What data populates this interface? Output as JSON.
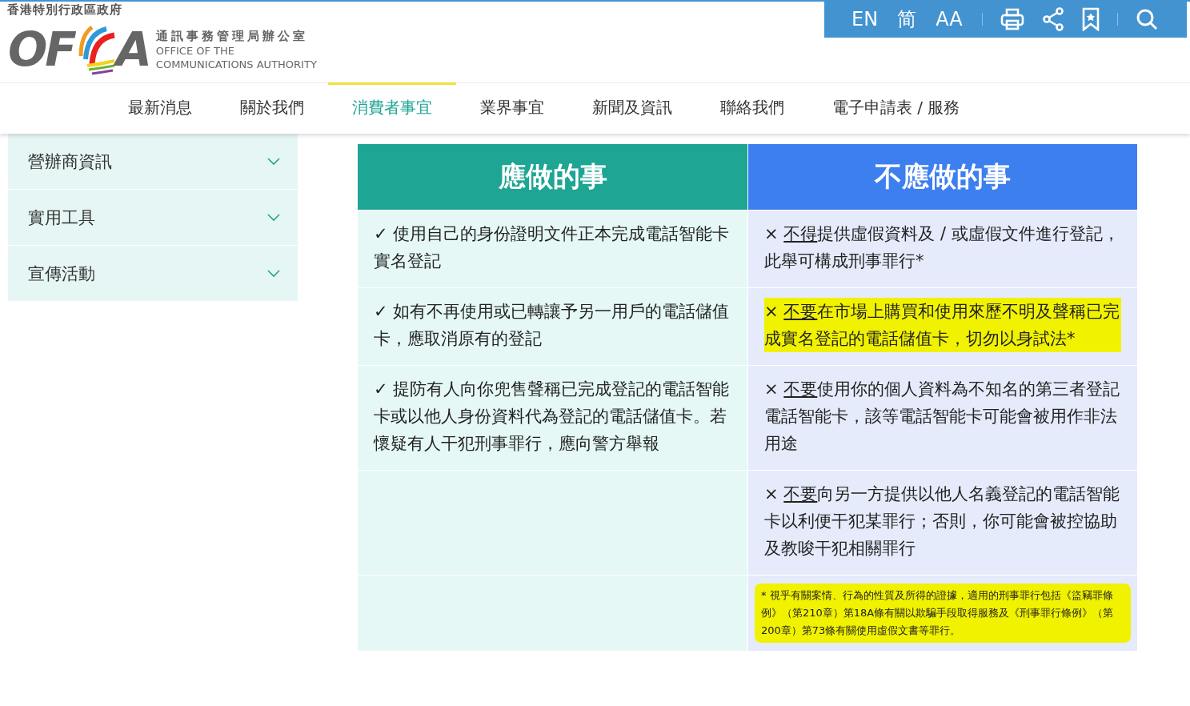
{
  "header": {
    "gov_title": "香港特別行政區政府",
    "logo": {
      "letters_left": "OF",
      "letters_right": "A",
      "name_zh": "通訊事務管理局辦公室",
      "name_en_1": "OFFICE OF THE",
      "name_en_2": "COMMUNICATIONS AUTHORITY"
    },
    "toolbar": {
      "language": "EN",
      "simplified": "简",
      "font_size": "AA"
    }
  },
  "nav": [
    {
      "label": "最新消息",
      "selected": false
    },
    {
      "label": "關於我們",
      "selected": false
    },
    {
      "label": "消費者事宜",
      "selected": true
    },
    {
      "label": "業界事宜",
      "selected": false
    },
    {
      "label": "新聞及資訊",
      "selected": false
    },
    {
      "label": "聯絡我們",
      "selected": false
    },
    {
      "label": "電子申請表 / 服務",
      "selected": false
    }
  ],
  "sidebar": {
    "items": [
      {
        "label": "營辦商資訊",
        "expanded": false
      },
      {
        "label": "實用工具",
        "expanded": false
      },
      {
        "label": "宣傳活動",
        "expanded": false
      }
    ]
  },
  "table": {
    "columns": [
      "應做的事",
      "不應做的事"
    ],
    "rows": [
      {
        "do": {
          "mark": "✓",
          "text": "使用自己的身份證明文件正本完成電話智能卡實名登記"
        },
        "dont": {
          "mark": "×",
          "underlined": "不得",
          "text": "提供虛假資料及 / 或虛假文件進行登記，此舉可構成刑事罪行*",
          "highlighted": false
        }
      },
      {
        "do": {
          "mark": "✓",
          "text": "如有不再使用或已轉讓予另一用戶的電話儲值卡，應取消原有的登記"
        },
        "dont": {
          "mark": "×",
          "underlined": "不要",
          "text": "在市場上購買和使用來歷不明及聲稱已完成實名登記的電話儲值卡，切勿以身試法*",
          "highlighted": true
        }
      },
      {
        "do": {
          "mark": "✓",
          "text": "提防有人向你兜售聲稱已完成登記的電話智能卡或以他人身份資料代為登記的電話儲值卡。若懷疑有人干犯刑事罪行，應向警方舉報"
        },
        "dont": {
          "mark": "×",
          "underlined": "不要",
          "text": "使用你的個人資料為不知名的第三者登記電話智能卡，該等電話智能卡可能會被用作非法用途",
          "highlighted": false
        }
      },
      {
        "dont": {
          "mark": "×",
          "underlined": "不要",
          "text": "向另一方提供以他人名義登記的電話智能卡以利便干犯某罪行；否則，你可能會被控協助及教唆干犯相關罪行",
          "highlighted": false
        }
      }
    ],
    "footnote": {
      "text": "* 視乎有關案情、行為的性質及所得的證據，適用的刑事罪行包括《盜竊罪條例》（第210章）第18A條有關以欺騙手段取得服務及《刑事罪行條例》（第200章）第73條有關使用虛假文書等罪行。",
      "highlighted": true
    }
  }
}
